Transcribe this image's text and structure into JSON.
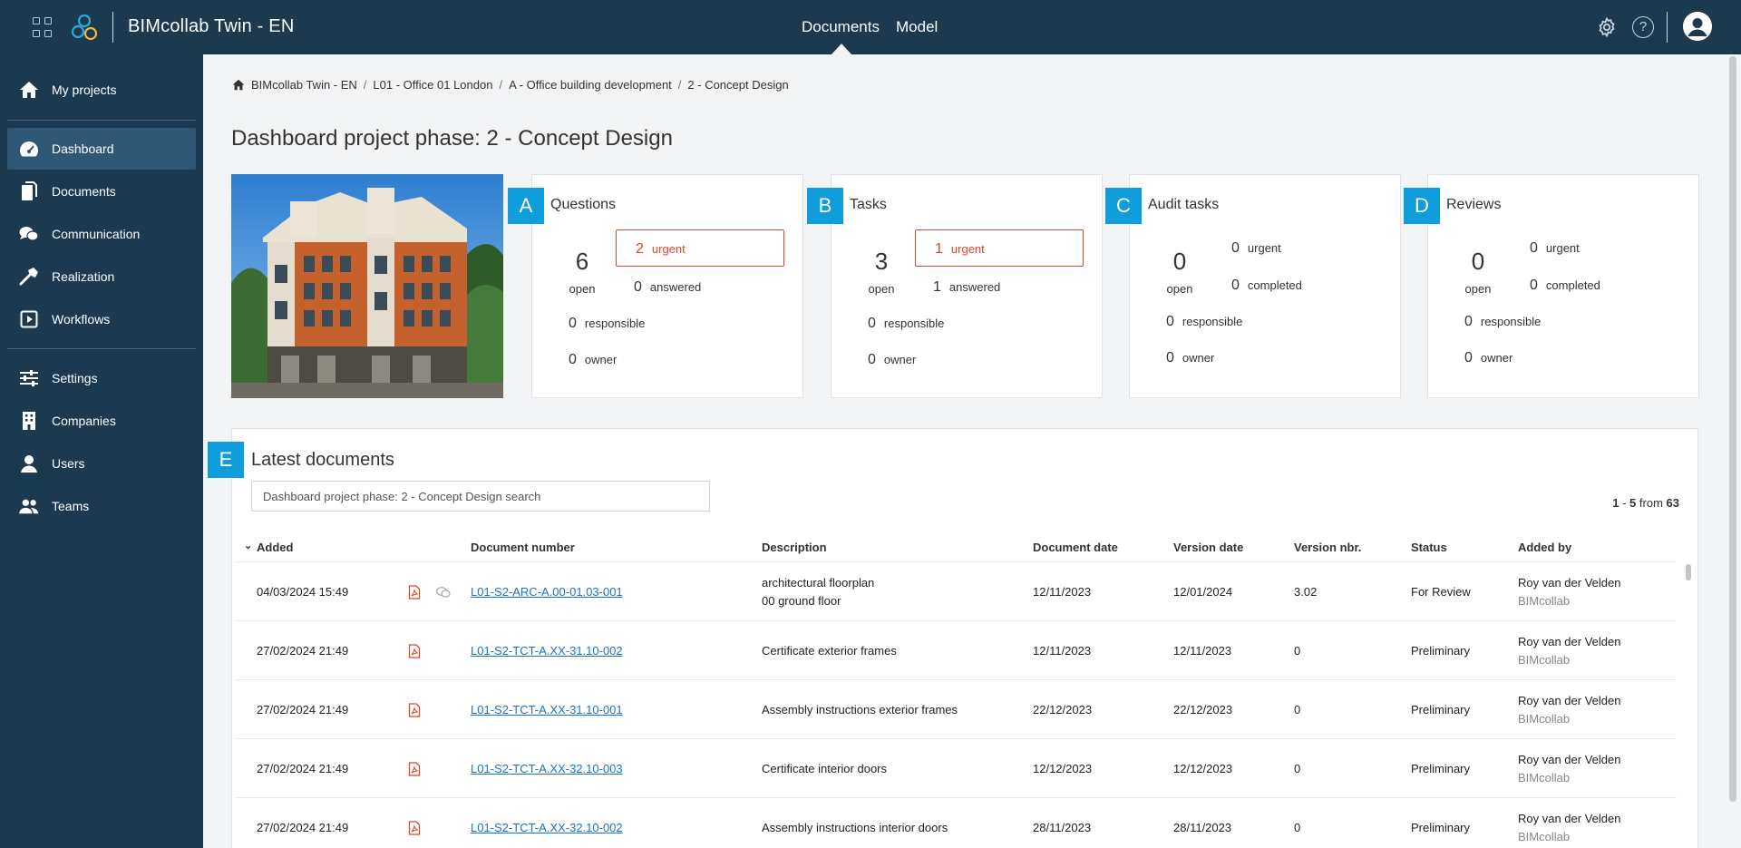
{
  "app": {
    "title": "BIMcollab Twin - EN",
    "nav": [
      {
        "label": "Documents",
        "active": true
      },
      {
        "label": "Model",
        "active": false
      }
    ],
    "icons": [
      "apps-grid-icon",
      "bimcollab-logo",
      "gear-icon",
      "help-icon",
      "user-avatar-icon"
    ],
    "help_glyph": "?"
  },
  "sidebar": {
    "items": [
      {
        "label": "My projects",
        "icon": "home-icon"
      },
      {
        "label": "Dashboard",
        "icon": "dashboard-icon",
        "active": true
      },
      {
        "label": "Documents",
        "icon": "documents-icon"
      },
      {
        "label": "Communication",
        "icon": "chat-icon"
      },
      {
        "label": "Realization",
        "icon": "hammer-icon"
      },
      {
        "label": "Workflows",
        "icon": "play-box-icon"
      },
      {
        "label": "Settings",
        "icon": "sliders-icon"
      },
      {
        "label": "Companies",
        "icon": "building-icon"
      },
      {
        "label": "Users",
        "icon": "user-icon"
      },
      {
        "label": "Teams",
        "icon": "group-icon"
      }
    ]
  },
  "breadcrumb": [
    "BIMcollab Twin - EN",
    "L01 - Office 01 London",
    "A - Office building development",
    "2 - Concept Design"
  ],
  "page_title": "Dashboard project phase: 2 - Concept Design",
  "cards": [
    {
      "badge": "A",
      "title": "Questions",
      "open": "6",
      "open_label": "open",
      "urgent": "2",
      "urgent_label": "urgent",
      "urgent_highlight": true,
      "second": "0",
      "second_label": "answered",
      "responsible": "0",
      "responsible_label": "responsible",
      "owner": "0",
      "owner_label": "owner"
    },
    {
      "badge": "B",
      "title": "Tasks",
      "open": "3",
      "open_label": "open",
      "urgent": "1",
      "urgent_label": "urgent",
      "urgent_highlight": true,
      "second": "1",
      "second_label": "answered",
      "responsible": "0",
      "responsible_label": "responsible",
      "owner": "0",
      "owner_label": "owner"
    },
    {
      "badge": "C",
      "title": "Audit tasks",
      "open": "0",
      "open_label": "open",
      "urgent": "0",
      "urgent_label": "urgent",
      "urgent_highlight": false,
      "second": "0",
      "second_label": "completed",
      "responsible": "0",
      "responsible_label": "responsible",
      "owner": "0",
      "owner_label": "owner"
    },
    {
      "badge": "D",
      "title": "Reviews",
      "open": "0",
      "open_label": "open",
      "urgent": "0",
      "urgent_label": "urgent",
      "urgent_highlight": false,
      "second": "0",
      "second_label": "completed",
      "responsible": "0",
      "responsible_label": "responsible",
      "owner": "0",
      "owner_label": "owner"
    }
  ],
  "documents": {
    "badge": "E",
    "title": "Latest documents",
    "search_placeholder": "Dashboard project phase: 2 - Concept Design search",
    "pager": {
      "from": "1",
      "dash": "-",
      "to": "5",
      "word": "from",
      "total": "63"
    },
    "sort_glyph": "⌄",
    "columns": [
      "Added",
      "Document number",
      "Description",
      "Document date",
      "Version date",
      "Version nbr.",
      "Status",
      "Added by"
    ],
    "rows": [
      {
        "added": "04/03/2024 15:49",
        "has_comment": true,
        "number": "L01-S2-ARC-A.00-01.03-001",
        "description": "architectural floorplan",
        "description2": "00 ground floor",
        "doc_date": "12/11/2023",
        "version_date": "12/01/2024",
        "version": "3.02",
        "status": "For Review",
        "added_by": "Roy van der Velden",
        "company": "BIMcollab"
      },
      {
        "added": "27/02/2024 21:49",
        "has_comment": false,
        "number": "L01-S2-TCT-A.XX-31.10-002",
        "description": "Certificate exterior frames",
        "description2": "",
        "doc_date": "12/11/2023",
        "version_date": "12/11/2023",
        "version": "0",
        "status": "Preliminary",
        "added_by": "Roy van der Velden",
        "company": "BIMcollab"
      },
      {
        "added": "27/02/2024 21:49",
        "has_comment": false,
        "number": "L01-S2-TCT-A.XX-31.10-001",
        "description": "Assembly instructions exterior frames",
        "description2": "",
        "doc_date": "22/12/2023",
        "version_date": "22/12/2023",
        "version": "0",
        "status": "Preliminary",
        "added_by": "Roy van der Velden",
        "company": "BIMcollab"
      },
      {
        "added": "27/02/2024 21:49",
        "has_comment": false,
        "number": "L01-S2-TCT-A.XX-32.10-003",
        "description": "Certificate interior doors",
        "description2": "",
        "doc_date": "12/12/2023",
        "version_date": "12/12/2023",
        "version": "0",
        "status": "Preliminary",
        "added_by": "Roy van der Velden",
        "company": "BIMcollab"
      },
      {
        "added": "27/02/2024 21:49",
        "has_comment": false,
        "number": "L01-S2-TCT-A.XX-32.10-002",
        "description": "Assembly instructions interior doors",
        "description2": "",
        "doc_date": "28/11/2023",
        "version_date": "28/11/2023",
        "version": "0",
        "status": "Preliminary",
        "added_by": "Roy van der Velden",
        "company": "BIMcollab"
      }
    ]
  },
  "colors": {
    "navy": "#1b3a50",
    "sidebar_active": "#2f5877",
    "badge_blue": "#0f9ddb",
    "urgent_red": "#d9472b",
    "link_blue": "#1a73c7"
  }
}
